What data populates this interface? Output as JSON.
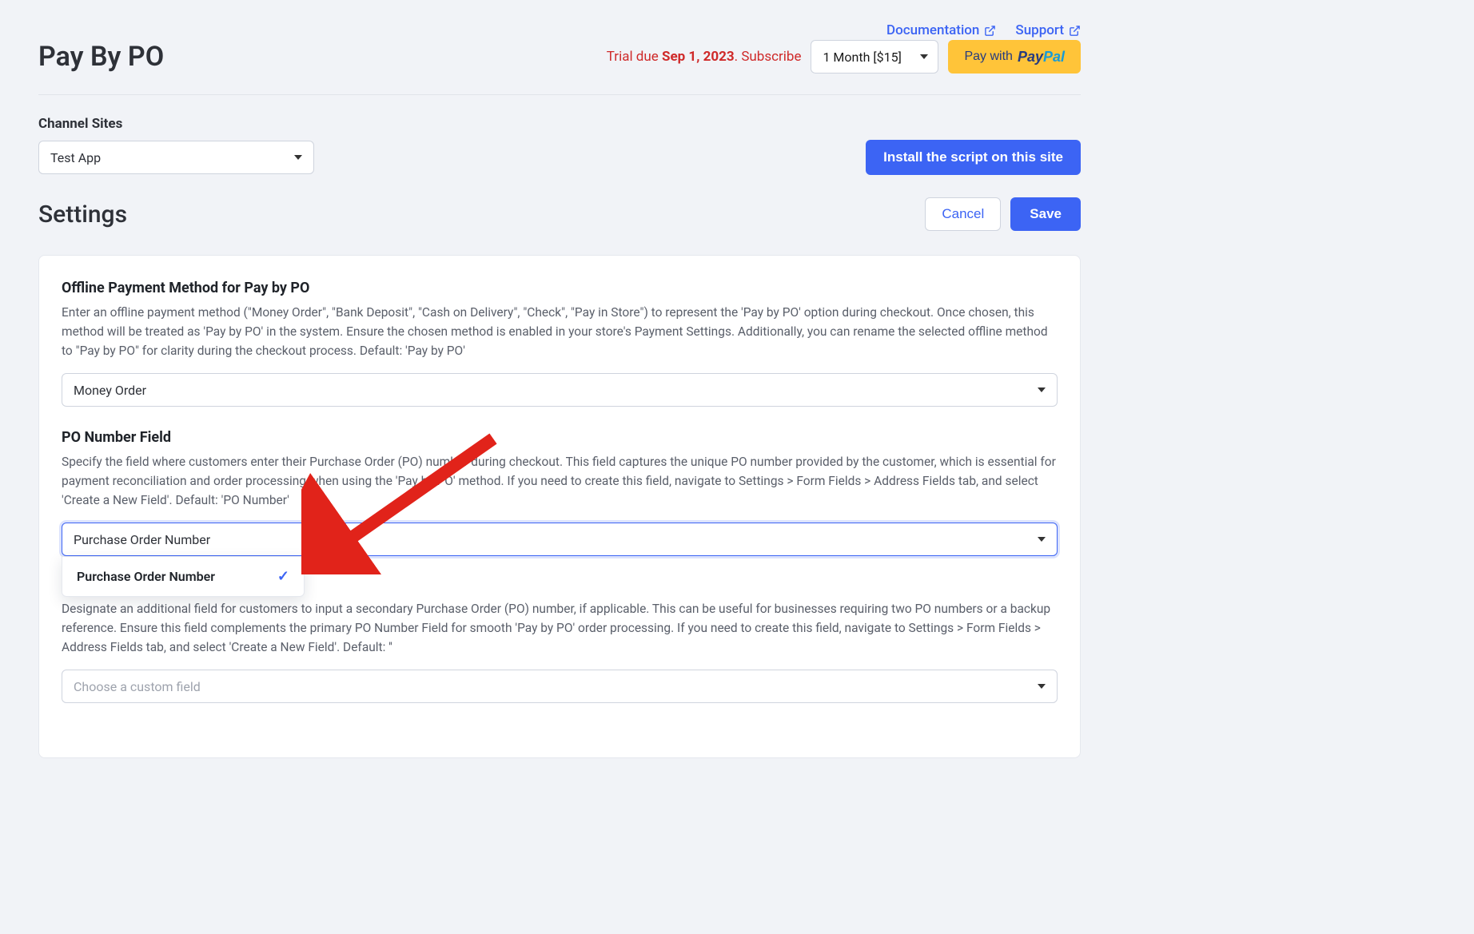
{
  "header": {
    "doc_link": "Documentation",
    "support_link": "Support",
    "title": "Pay By PO",
    "trial_prefix": "Trial due",
    "trial_date": "Sep 1, 2023",
    "trial_suffix": ".",
    "subscribe": "Subscribe",
    "month_option": "1 Month [$15]",
    "paypal_prefix": "Pay with"
  },
  "channel": {
    "label": "Channel Sites",
    "selected": "Test App",
    "install_btn": "Install the script on this site"
  },
  "settings": {
    "title": "Settings",
    "cancel": "Cancel",
    "save": "Save"
  },
  "fields": {
    "offline": {
      "title": "Offline Payment Method for Pay by PO",
      "desc": "Enter an offline payment method (\"Money Order\", \"Bank Deposit\", \"Cash on Delivery\", \"Check\", \"Pay in Store\") to represent the 'Pay by PO' option during checkout. Once chosen, this method will be treated as 'Pay by PO' in the system. Ensure the chosen method is enabled in your store's Payment Settings. Additionally, you can rename the selected offline method to \"Pay by PO\" for clarity during the checkout process. Default: 'Pay by PO'",
      "value": "Money Order"
    },
    "po_number": {
      "title": "PO Number Field",
      "desc": "Specify the field where customers enter their Purchase Order (PO) number during checkout. This field captures the unique PO number provided by the customer, which is essential for payment reconciliation and order processing when using the 'Pay by PO' method. If you need to create this field, navigate to Settings > Form Fields > Address Fields tab, and select 'Create a New Field'. Default: 'PO Number'",
      "value": "Purchase Order Number",
      "option1": "Purchase Order Number"
    },
    "secondary": {
      "desc": "Designate an additional field for customers to input a secondary Purchase Order (PO) number, if applicable. This can be useful for businesses requiring two PO numbers or a backup reference. Ensure this field complements the primary PO Number Field for smooth 'Pay by PO' order processing. If you need to create this field, navigate to Settings > Form Fields > Address Fields tab, and select 'Create a New Field'. Default: ''",
      "placeholder": "Choose a custom field"
    }
  }
}
